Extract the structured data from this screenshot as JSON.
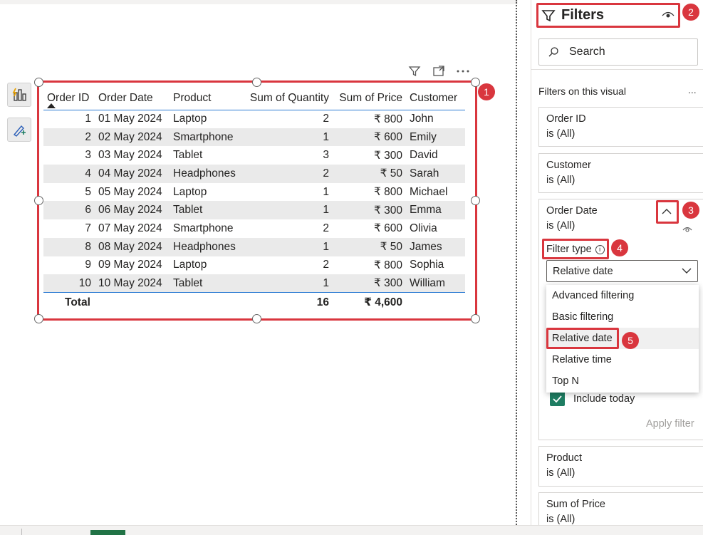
{
  "table": {
    "headers": [
      "Order ID",
      "Order Date",
      "Product",
      "Sum of Quantity",
      "Sum of Price",
      "Customer"
    ],
    "rows": [
      [
        "1",
        "01 May 2024",
        "Laptop",
        "2",
        "₹ 800",
        "John"
      ],
      [
        "2",
        "02 May 2024",
        "Smartphone",
        "1",
        "₹ 600",
        "Emily"
      ],
      [
        "3",
        "03 May 2024",
        "Tablet",
        "3",
        "₹ 300",
        "David"
      ],
      [
        "4",
        "04 May 2024",
        "Headphones",
        "2",
        "₹ 50",
        "Sarah"
      ],
      [
        "5",
        "05 May 2024",
        "Laptop",
        "1",
        "₹ 800",
        "Michael"
      ],
      [
        "6",
        "06 May 2024",
        "Tablet",
        "1",
        "₹ 300",
        "Emma"
      ],
      [
        "7",
        "07 May 2024",
        "Smartphone",
        "2",
        "₹ 600",
        "Olivia"
      ],
      [
        "8",
        "08 May 2024",
        "Headphones",
        "1",
        "₹ 50",
        "James"
      ],
      [
        "9",
        "09 May 2024",
        "Laptop",
        "2",
        "₹ 800",
        "Sophia"
      ],
      [
        "10",
        "10 May 2024",
        "Tablet",
        "1",
        "₹ 300",
        "William"
      ]
    ],
    "total": {
      "label": "Total",
      "quantity": "16",
      "price": "₹ 4,600"
    }
  },
  "filters": {
    "title": "Filters",
    "search_label": "Search",
    "section_label": "Filters on this visual",
    "more": "...",
    "cards": {
      "order_id": {
        "name": "Order ID",
        "value": "is (All)"
      },
      "customer": {
        "name": "Customer",
        "value": "is (All)"
      },
      "order_date": {
        "name": "Order Date",
        "value": "is (All)"
      },
      "product": {
        "name": "Product",
        "value": "is (All)"
      },
      "sum_of_price": {
        "name": "Sum of Price",
        "value": "is (All)"
      }
    },
    "filter_type_label": "Filter type",
    "filter_type_value": "Relative date",
    "options": [
      "Advanced filtering",
      "Basic filtering",
      "Relative date",
      "Relative time",
      "Top N"
    ],
    "selected_option": "Relative date",
    "include_today": "Include today",
    "apply": "Apply filter"
  },
  "badges": [
    "1",
    "2",
    "3",
    "4",
    "5"
  ],
  "colors": {
    "accent_red": "#d9363e",
    "check_green": "#1e7d62",
    "header_line": "#2b7bd3"
  }
}
